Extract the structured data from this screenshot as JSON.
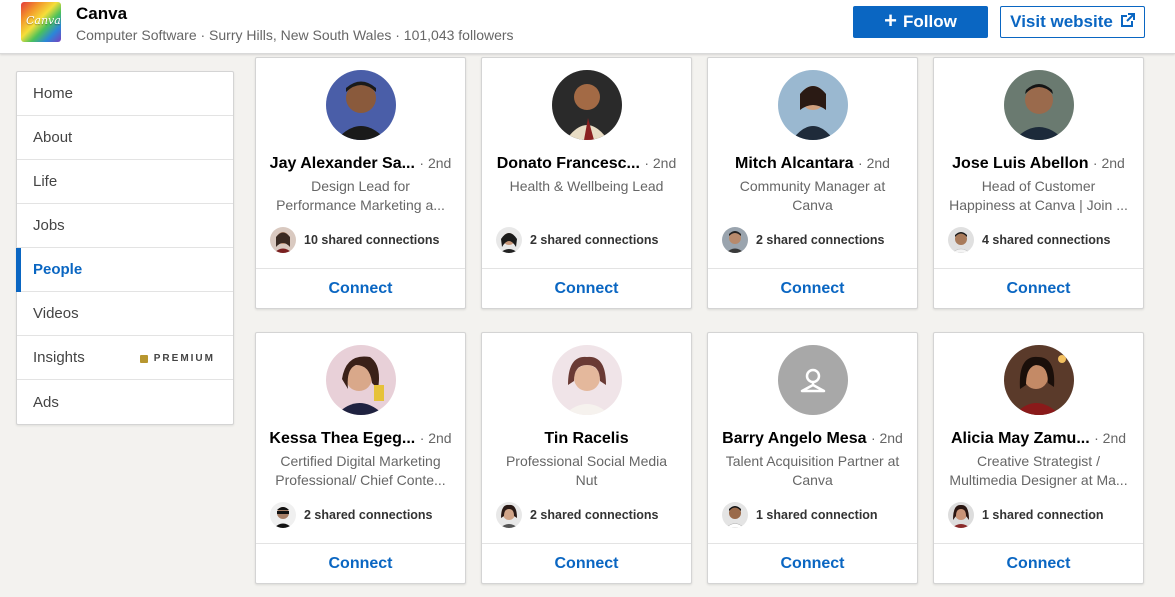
{
  "company": {
    "logo_text": "Canva",
    "name": "Canva",
    "meta": "Computer Software · Surry Hills, New South Wales · 101,043 followers",
    "follow_label": "Follow",
    "visit_label": "Visit website"
  },
  "sidebar": {
    "items": [
      {
        "label": "Home"
      },
      {
        "label": "About"
      },
      {
        "label": "Life"
      },
      {
        "label": "Jobs"
      },
      {
        "label": "People",
        "active": true
      },
      {
        "label": "Videos"
      },
      {
        "label": "Insights",
        "badge": "PREMIUM"
      },
      {
        "label": "Ads"
      }
    ]
  },
  "people": [
    {
      "name": "Jay Alexander Sa...",
      "degree": "· 2nd",
      "headline": "Design Lead for Performance Marketing a...",
      "shared": "10 shared connections",
      "connect": "Connect"
    },
    {
      "name": "Donato Francesc...",
      "degree": "· 2nd",
      "headline": "Health & Wellbeing Lead",
      "shared": "2 shared connections",
      "connect": "Connect"
    },
    {
      "name": "Mitch Alcantara",
      "degree": "· 2nd",
      "headline": "Community Manager at Canva",
      "shared": "2 shared connections",
      "connect": "Connect"
    },
    {
      "name": "Jose Luis Abellon",
      "degree": "· 2nd",
      "headline": "Head of Customer Happiness at Canva | Join ...",
      "shared": "4 shared connections",
      "connect": "Connect"
    },
    {
      "name": "Kessa Thea Egeg...",
      "degree": "· 2nd",
      "headline": "Certified Digital Marketing Professional/ Chief Conte...",
      "shared": "2 shared connections",
      "connect": "Connect"
    },
    {
      "name": "Tin Racelis",
      "degree": "",
      "headline": "Professional Social Media Nut",
      "shared": "2 shared connections",
      "connect": "Connect"
    },
    {
      "name": "Barry Angelo Mesa",
      "degree": "· 2nd",
      "headline": "Talent Acquisition Partner at Canva",
      "shared": "1 shared connection",
      "connect": "Connect"
    },
    {
      "name": "Alicia May Zamu...",
      "degree": "· 2nd",
      "headline": "Creative Strategist / Multimedia Designer at Ma...",
      "shared": "1 shared connection",
      "connect": "Connect"
    }
  ],
  "colors": {
    "accent": "#0a66c2",
    "premium": "#b7962f"
  }
}
